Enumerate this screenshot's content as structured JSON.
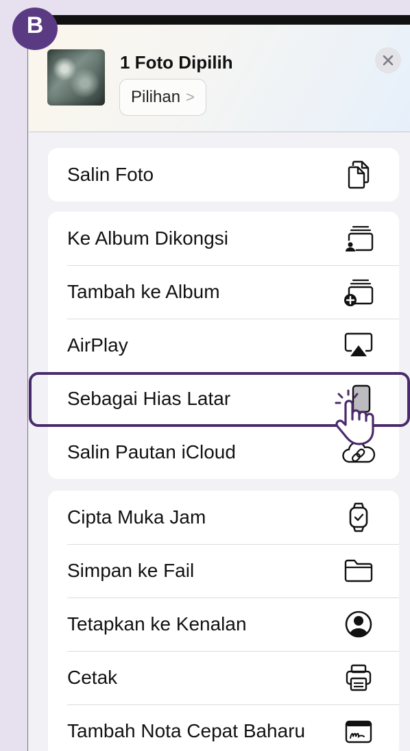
{
  "step_badge": "B",
  "header": {
    "title": "1 Foto Dipilih",
    "options_label": "Pilihan",
    "options_chevron": ">"
  },
  "groups": [
    {
      "items": [
        {
          "label": "Salin Foto",
          "icon": "copy-doc-icon"
        }
      ]
    },
    {
      "items": [
        {
          "label": "Ke Album Dikongsi",
          "icon": "shared-album-icon"
        },
        {
          "label": "Tambah ke Album",
          "icon": "add-album-icon"
        },
        {
          "label": "AirPlay",
          "icon": "airplay-icon"
        },
        {
          "label": "Sebagai Hias Latar",
          "icon": "wallpaper-phone-icon",
          "highlighted": true
        },
        {
          "label": "Salin Pautan iCloud",
          "icon": "icloud-link-icon"
        }
      ]
    },
    {
      "items": [
        {
          "label": "Cipta Muka Jam",
          "icon": "watch-icon"
        },
        {
          "label": "Simpan ke Fail",
          "icon": "folder-icon"
        },
        {
          "label": "Tetapkan ke Kenalan",
          "icon": "contact-icon"
        },
        {
          "label": "Cetak",
          "icon": "printer-icon"
        },
        {
          "label": "Tambah Nota Cepat Baharu",
          "icon": "quick-note-icon"
        }
      ]
    }
  ],
  "colors": {
    "accent": "#5b3a84",
    "highlight_border": "#4a2a6b",
    "page_bg": "#e6e0ef",
    "sheet_bg": "#f2f2f6"
  }
}
